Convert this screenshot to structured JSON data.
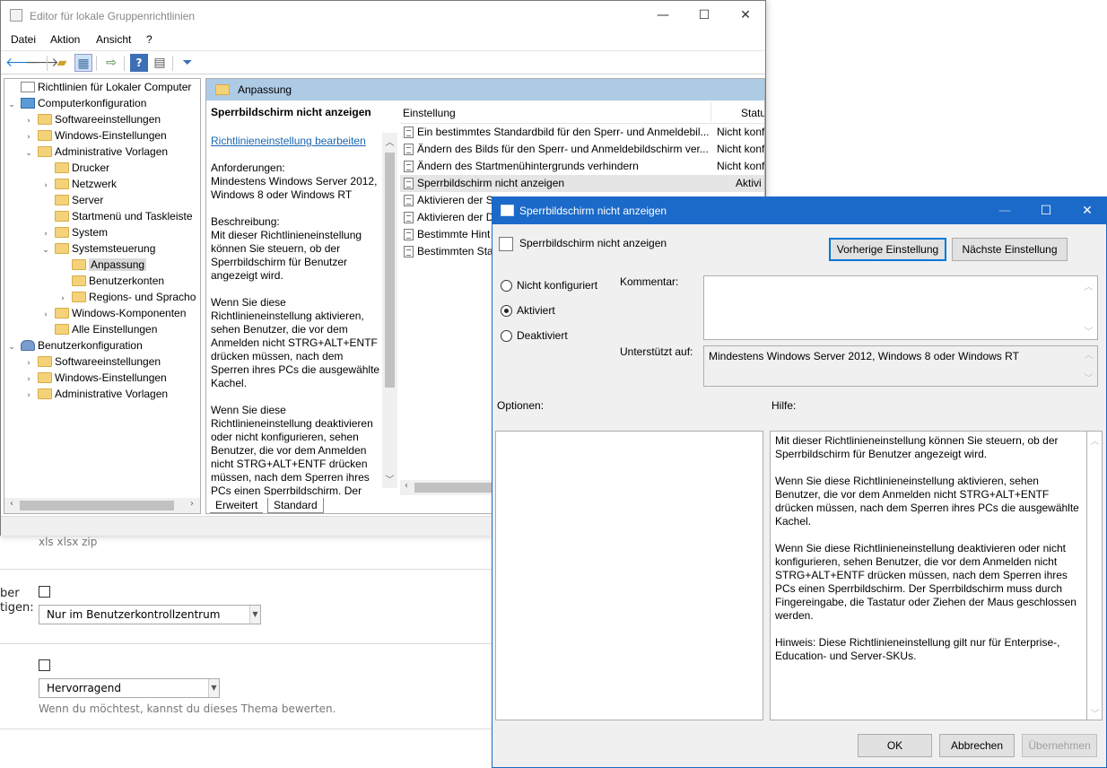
{
  "background_form": {
    "file_types": "xls xlsx zip",
    "label_ber": "ber",
    "label_tigen": "tigen:",
    "select1_value": "Nur im Benutzerkontrollzentrum",
    "select2_value": "Hervorragend",
    "rating_hint": "Wenn du möchtest, kannst du dieses Thema bewerten."
  },
  "main_window": {
    "title": "Editor für lokale Gruppenrichtlinien",
    "menu": [
      "Datei",
      "Aktion",
      "Ansicht",
      "?"
    ],
    "tree": [
      {
        "label": "Richtlinien für Lokaler Computer",
        "icon": "policy-doc-icon",
        "expander": ""
      },
      {
        "label": "Computerkonfiguration",
        "icon": "computer-icon",
        "expander": "⌄"
      },
      {
        "label": "Softwareeinstellungen",
        "icon": "folder-icon",
        "expander": "›"
      },
      {
        "label": "Windows-Einstellungen",
        "icon": "folder-icon",
        "expander": "›"
      },
      {
        "label": "Administrative Vorlagen",
        "icon": "folder-icon",
        "expander": "⌄"
      },
      {
        "label": "Drucker",
        "icon": "folder-icon",
        "expander": ""
      },
      {
        "label": "Netzwerk",
        "icon": "folder-icon",
        "expander": "›"
      },
      {
        "label": "Server",
        "icon": "folder-icon",
        "expander": ""
      },
      {
        "label": "Startmenü und Taskleiste",
        "icon": "folder-icon",
        "expander": ""
      },
      {
        "label": "System",
        "icon": "folder-icon",
        "expander": "›"
      },
      {
        "label": "Systemsteuerung",
        "icon": "folder-icon",
        "expander": "⌄"
      },
      {
        "label": "Anpassung",
        "icon": "folder-icon",
        "expander": ""
      },
      {
        "label": "Benutzerkonten",
        "icon": "folder-icon",
        "expander": ""
      },
      {
        "label": "Regions- und Spracho",
        "icon": "folder-icon",
        "expander": "›"
      },
      {
        "label": "Windows-Komponenten",
        "icon": "folder-icon",
        "expander": "›"
      },
      {
        "label": "Alle Einstellungen",
        "icon": "settings-folder-icon",
        "expander": ""
      },
      {
        "label": "Benutzerkonfiguration",
        "icon": "user-icon",
        "expander": "⌄"
      },
      {
        "label": "Softwareeinstellungen",
        "icon": "folder-icon",
        "expander": "›"
      },
      {
        "label": "Windows-Einstellungen",
        "icon": "folder-icon",
        "expander": "›"
      },
      {
        "label": "Administrative Vorlagen",
        "icon": "folder-icon",
        "expander": "›"
      }
    ],
    "section_title": "Anpassung",
    "description": {
      "title": "Sperrbildschirm nicht anzeigen",
      "edit_link": "Richtlinieneinstellung bearbeiten",
      "requirements": "Anforderungen:\nMindestens Windows Server 2012, Windows 8 oder Windows RT",
      "description": "Beschreibung:\nMit dieser Richtlinieneinstellung können Sie steuern, ob der Sperrbildschirm für Benutzer angezeigt wird.",
      "enabled_text": "Wenn Sie diese Richtlinieneinstellung aktivieren, sehen Benutzer, die vor dem Anmelden nicht STRG+ALT+ENTF drücken müssen, nach dem Sperren ihres PCs die ausgewählte Kachel.",
      "disabled_text": "Wenn Sie diese Richtlinieneinstellung deaktivieren oder nicht konfigurieren, sehen Benutzer, die vor dem Anmelden nicht STRG+ALT+ENTF drücken müssen, nach dem Sperren ihres PCs einen Sperrbildschirm. Der"
    },
    "list_columns": {
      "setting": "Einstellung",
      "status": "Statu"
    },
    "list_rows": [
      {
        "name": "Ein bestimmtes Standardbild für den Sperr- und Anmeldebil...",
        "state": "Nicht konf"
      },
      {
        "name": "Ändern des Bilds für den Sperr- und Anmeldebildschirm ver...",
        "state": "Nicht konf"
      },
      {
        "name": "Ändern des Startmenühintergrunds verhindern",
        "state": "Nicht konf"
      },
      {
        "name": "Sperrbildschirm nicht anzeigen",
        "state": "Aktivi"
      },
      {
        "name": "Aktivieren der Sp",
        "state": ""
      },
      {
        "name": "Aktivieren der D",
        "state": ""
      },
      {
        "name": "Bestimmte Hint",
        "state": ""
      },
      {
        "name": "Bestimmten Star",
        "state": ""
      }
    ],
    "tabs": [
      "Erweitert",
      "Standard"
    ]
  },
  "dialog": {
    "title": "Sperrbildschirm nicht anzeigen",
    "policy_name": "Sperrbildschirm nicht anzeigen",
    "prev_button": "Vorherige Einstellung",
    "next_button": "Nächste Einstellung",
    "radio_not_configured": "Nicht konfiguriert",
    "radio_enabled": "Aktiviert",
    "radio_disabled": "Deaktiviert",
    "selected_option": "Aktiviert",
    "comment_label": "Kommentar:",
    "comment_value": "",
    "supported_label": "Unterstützt auf:",
    "supported_value": "Mindestens Windows Server 2012, Windows 8 oder Windows RT",
    "options_label": "Optionen:",
    "help_label": "Hilfe:",
    "help_text": "Mit dieser Richtlinieneinstellung können Sie steuern, ob der Sperrbildschirm für Benutzer angezeigt wird.\n\nWenn Sie diese Richtlinieneinstellung aktivieren, sehen Benutzer, die vor dem Anmelden nicht STRG+ALT+ENTF drücken müssen, nach dem Sperren ihres PCs die ausgewählte Kachel.\n\nWenn Sie diese Richtlinieneinstellung deaktivieren oder nicht konfigurieren, sehen Benutzer, die vor dem Anmelden nicht STRG+ALT+ENTF drücken müssen, nach dem Sperren ihres PCs einen Sperrbildschirm. Der Sperrbildschirm muss durch Fingereingabe, die Tastatur oder Ziehen der Maus geschlossen werden.\n\nHinweis: Diese Richtlinieneinstellung gilt nur für Enterprise-, Education- und Server-SKUs.",
    "ok_button": "OK",
    "cancel_button": "Abbrechen",
    "apply_button": "Übernehmen"
  },
  "colors": {
    "dialog_titlebar": "#1b6ac9",
    "section_header": "#aecbe6",
    "link": "#1a66b3"
  }
}
